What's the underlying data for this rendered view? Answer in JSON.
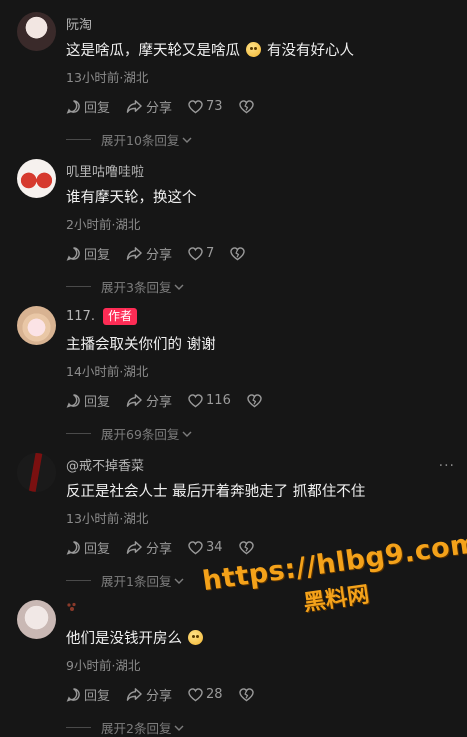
{
  "comments": [
    {
      "username": "阮淘",
      "text_before_emoji": "这是啥瓜，摩天轮又是啥瓜",
      "text_after_emoji": "有没有好心人",
      "meta": "13小时前·湖北",
      "reply_label": "回复",
      "share_label": "分享",
      "likes": "73",
      "expand_label": "展开10条回复"
    },
    {
      "username": "叽里咕噜哇啦",
      "text_before_emoji": "谁有摩天轮，换这个",
      "text_after_emoji": "",
      "meta": "2小时前·湖北",
      "reply_label": "回复",
      "share_label": "分享",
      "likes": "7",
      "expand_label": "展开3条回复"
    },
    {
      "username": "117.",
      "author_badge": "作者",
      "text_before_emoji": "主播会取关你们的 谢谢",
      "text_after_emoji": "",
      "meta": "14小时前·湖北",
      "reply_label": "回复",
      "share_label": "分享",
      "likes": "116",
      "expand_label": "展开69条回复"
    },
    {
      "username": "@戒不掉香菜",
      "text_before_emoji": "反正是社会人士 最后开着奔驰走了 抓都住不住",
      "text_after_emoji": "",
      "meta": "13小时前·湖北",
      "reply_label": "回复",
      "share_label": "分享",
      "likes": "34",
      "expand_label": "展开1条回复"
    },
    {
      "username": "",
      "text_before_emoji": "他们是没钱开房么",
      "text_after_emoji": "",
      "meta": "9小时前·湖北",
      "reply_label": "回复",
      "share_label": "分享",
      "likes": "28",
      "expand_label": "展开2条回复"
    }
  ],
  "more_menu": "···",
  "watermark": {
    "url": "https://hlbg9.com",
    "name": "黑料网"
  },
  "colors": {
    "background": "#161616",
    "author_badge": "#fe2c55",
    "watermark": "#f4a21a"
  }
}
